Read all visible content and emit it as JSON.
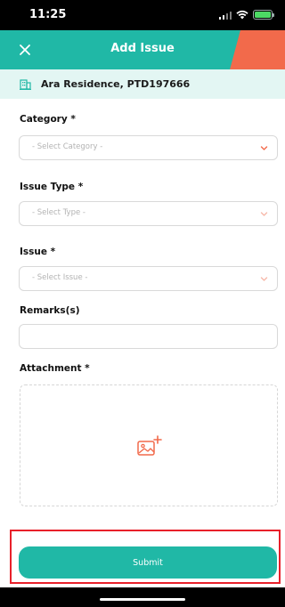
{
  "status_bar": {
    "time": "11:25"
  },
  "header": {
    "title": "Add Issue",
    "close_icon": "close-icon",
    "accent_color": "#20b8a6",
    "corner_color": "#f26a4b"
  },
  "property": {
    "icon": "building-icon",
    "name": "Ara Residence, PTD197666"
  },
  "form": {
    "category": {
      "label": "Category *",
      "placeholder": "- Select Category -"
    },
    "issue_type": {
      "label": "Issue Type *",
      "placeholder": "- Select Type -"
    },
    "issue": {
      "label": "Issue *",
      "placeholder": "- Select Issue -"
    },
    "remarks": {
      "label": "Remarks(s)",
      "value": ""
    },
    "attachment": {
      "label": "Attachment *",
      "icon": "add-image-icon"
    }
  },
  "submit": {
    "label": "Submit",
    "highlight_color": "#e8202a"
  }
}
